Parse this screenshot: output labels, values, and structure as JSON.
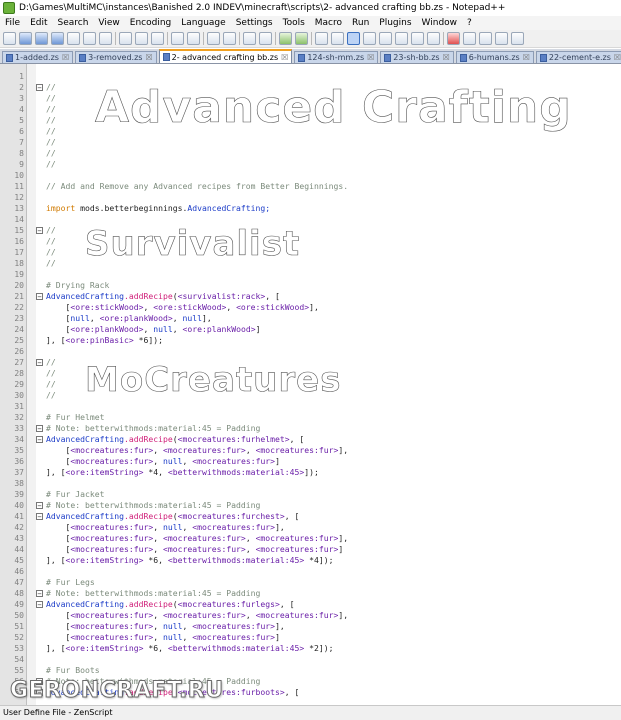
{
  "window": {
    "title": "D:\\Games\\MultiMC\\instances\\Banished 2.0 INDEV\\minecraft\\scripts\\2- advanced crafting bb.zs - Notepad++"
  },
  "menu": [
    "File",
    "Edit",
    "Search",
    "View",
    "Encoding",
    "Language",
    "Settings",
    "Tools",
    "Macro",
    "Run",
    "Plugins",
    "Window",
    "?"
  ],
  "tabs": [
    {
      "label": "1-added.zs",
      "active": false
    },
    {
      "label": "3-removed.zs",
      "active": false
    },
    {
      "label": "2- advanced crafting bb.zs",
      "active": true
    },
    {
      "label": "124-sh-mm.zs",
      "active": false
    },
    {
      "label": "23-sh-bb.zs",
      "active": false
    },
    {
      "label": "6-humans.zs",
      "active": false
    },
    {
      "label": "22-cement-e.zs",
      "active": false
    }
  ],
  "banners": {
    "advanced": "Advanced Crafting",
    "survivalist": "Survivalist",
    "mocreatures": "MoCreatures"
  },
  "lines": [
    {
      "n": "1",
      "code": ""
    },
    {
      "n": "2",
      "code": "//"
    },
    {
      "n": "3",
      "code": "//"
    },
    {
      "n": "4",
      "code": "//"
    },
    {
      "n": "5",
      "code": "//"
    },
    {
      "n": "6",
      "code": "//"
    },
    {
      "n": "7",
      "code": "//"
    },
    {
      "n": "8",
      "code": "//"
    },
    {
      "n": "9",
      "code": "//"
    },
    {
      "n": "10",
      "code": ""
    },
    {
      "n": "11",
      "code": "// Add and Remove any Advanced recipes from Better Beginnings."
    },
    {
      "n": "12",
      "code": ""
    },
    {
      "n": "13",
      "code_k": "import ",
      "code_t": "mods.betterbeginnings.",
      "code_b": "AdvancedCrafting;"
    },
    {
      "n": "14",
      "code": ""
    },
    {
      "n": "15",
      "code": "//"
    },
    {
      "n": "16",
      "code": "//"
    },
    {
      "n": "17",
      "code": "//"
    },
    {
      "n": "18",
      "code": "//"
    },
    {
      "n": "19",
      "code": ""
    },
    {
      "n": "20",
      "code": "# Drying Rack"
    },
    {
      "n": "21",
      "code": "AdvancedCrafting.addRecipe(<survivalist:rack>, ["
    },
    {
      "n": "22",
      "code": "    [<ore:stickWood>, <ore:stickWood>, <ore:stickWood>],"
    },
    {
      "n": "23",
      "code": "    [null, <ore:plankWood>, null],"
    },
    {
      "n": "24",
      "code": "    [<ore:plankWood>, null, <ore:plankWood>]"
    },
    {
      "n": "25",
      "code": "], [<ore:pinBasic> *6]);"
    },
    {
      "n": "26",
      "code": ""
    },
    {
      "n": "27",
      "code": "//"
    },
    {
      "n": "28",
      "code": "//"
    },
    {
      "n": "29",
      "code": "//"
    },
    {
      "n": "30",
      "code": "//"
    },
    {
      "n": "31",
      "code": ""
    },
    {
      "n": "32",
      "code": "# Fur Helmet"
    },
    {
      "n": "33",
      "code": "# Note: betterwithmods:material:45 = Padding"
    },
    {
      "n": "34",
      "code": "AdvancedCrafting.addRecipe(<mocreatures:furhelmet>, ["
    },
    {
      "n": "35",
      "code": "    [<mocreatures:fur>, <mocreatures:fur>, <mocreatures:fur>],"
    },
    {
      "n": "36",
      "code": "    [<mocreatures:fur>, null, <mocreatures:fur>]"
    },
    {
      "n": "37",
      "code": "], [<ore:itemString> *4, <betterwithmods:material:45>]);"
    },
    {
      "n": "38",
      "code": ""
    },
    {
      "n": "39",
      "code": "# Fur Jacket"
    },
    {
      "n": "40",
      "code": "# Note: betterwithmods:material:45 = Padding"
    },
    {
      "n": "41",
      "code": "AdvancedCrafting.addRecipe(<mocreatures:furchest>, ["
    },
    {
      "n": "42",
      "code": "    [<mocreatures:fur>, null, <mocreatures:fur>],"
    },
    {
      "n": "43",
      "code": "    [<mocreatures:fur>, <mocreatures:fur>, <mocreatures:fur>],"
    },
    {
      "n": "44",
      "code": "    [<mocreatures:fur>, <mocreatures:fur>, <mocreatures:fur>]"
    },
    {
      "n": "45",
      "code": "], [<ore:itemString> *6, <betterwithmods:material:45> *4]);"
    },
    {
      "n": "46",
      "code": ""
    },
    {
      "n": "47",
      "code": "# Fur Legs"
    },
    {
      "n": "48",
      "code": "# Note: betterwithmods:material:45 = Padding"
    },
    {
      "n": "49",
      "code": "AdvancedCrafting.addRecipe(<mocreatures:furlegs>, ["
    },
    {
      "n": "50",
      "code": "    [<mocreatures:fur>, <mocreatures:fur>, <mocreatures:fur>],"
    },
    {
      "n": "51",
      "code": "    [<mocreatures:fur>, null, <mocreatures:fur>],"
    },
    {
      "n": "52",
      "code": "    [<mocreatures:fur>, null, <mocreatures:fur>]"
    },
    {
      "n": "53",
      "code": "], [<ore:itemString> *6, <betterwithmods:material:45> *2]);"
    },
    {
      "n": "54",
      "code": ""
    },
    {
      "n": "55",
      "code": "# Fur Boots"
    },
    {
      "n": "56",
      "code": "# Note: betterwithmods:material:45 = Padding"
    },
    {
      "n": "57",
      "code": "AdvancedCrafting.addRecipe(<mocreatures:furboots>, ["
    }
  ],
  "status": "User Define File - ZenScript",
  "watermark": "GERONCRAFT.RU"
}
